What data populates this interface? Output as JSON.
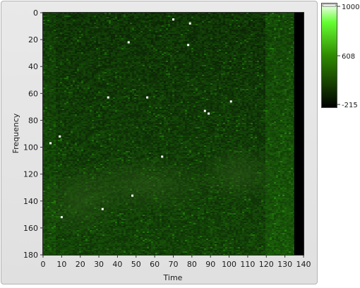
{
  "chart_data": {
    "type": "heatmap",
    "title": "",
    "xlabel": "Time",
    "ylabel": "Frequency",
    "xlim": [
      0,
      140
    ],
    "ylim": [
      0,
      180
    ],
    "y_axis_inverted": true,
    "x_ticks": [
      "0",
      "10",
      "20",
      "30",
      "40",
      "50",
      "60",
      "70",
      "80",
      "90",
      "100",
      "110",
      "120",
      "130",
      "140"
    ],
    "y_ticks": [
      "0",
      "20",
      "40",
      "60",
      "80",
      "100",
      "120",
      "140",
      "160",
      "180"
    ],
    "data_extent": {
      "time": [
        0,
        135
      ],
      "frequency": [
        0,
        180
      ]
    },
    "colormap": {
      "min_label": "-215",
      "mid_label": "608",
      "max_label": "1000",
      "min_color": "#000000",
      "mid_color": "#2f8a00",
      "max_color": "#ffffff",
      "scale_peak_color": "#66ff33"
    },
    "grid": false,
    "background_level": "low (dark green noise, brighter near Frequency 120-180 and Time 120-135)",
    "bright_points": [
      {
        "time": 46,
        "frequency": 22
      },
      {
        "time": 70,
        "frequency": 5
      },
      {
        "time": 79,
        "frequency": 8
      },
      {
        "time": 78,
        "frequency": 24
      },
      {
        "time": 35,
        "frequency": 63
      },
      {
        "time": 56,
        "frequency": 63
      },
      {
        "time": 87,
        "frequency": 73
      },
      {
        "time": 89,
        "frequency": 75
      },
      {
        "time": 101,
        "frequency": 66
      },
      {
        "time": 64,
        "frequency": 107
      },
      {
        "time": 48,
        "frequency": 136
      },
      {
        "time": 32,
        "frequency": 146
      },
      {
        "time": 9,
        "frequency": 92
      },
      {
        "time": 4,
        "frequency": 97
      },
      {
        "time": 10,
        "frequency": 152
      }
    ]
  },
  "colors": {
    "panel_bg": "#e4e4e4",
    "plot_border": "#2e2e2e",
    "empty_band": "#000000"
  }
}
